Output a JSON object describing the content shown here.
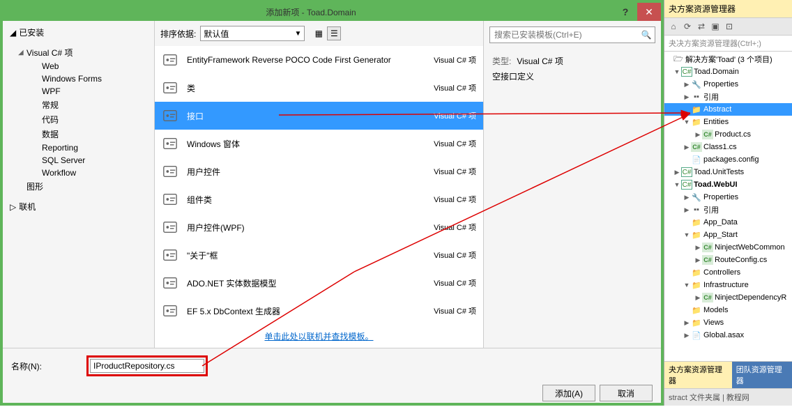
{
  "dialog": {
    "title": "添加新项 - Toad.Domain",
    "help": "?",
    "close": "✕"
  },
  "leftPanel": {
    "installed": "已安装",
    "csharpItems": "Visual C# 项",
    "items": [
      "Web",
      "Windows Forms",
      "WPF",
      "常规",
      "代码",
      "数据",
      "Reporting",
      "SQL Server",
      "Workflow"
    ],
    "graphics": "图形",
    "online": "联机"
  },
  "center": {
    "sortLabel": "排序依据:",
    "sortValue": "默认值",
    "templates": [
      {
        "name": "EntityFramework Reverse POCO Code First Generator",
        "lang": "Visual C# 项"
      },
      {
        "name": "类",
        "lang": "Visual C# 项"
      },
      {
        "name": "接口",
        "lang": "Visual C# 项",
        "selected": true
      },
      {
        "name": "Windows 窗体",
        "lang": "Visual C# 项"
      },
      {
        "name": "用户控件",
        "lang": "Visual C# 项"
      },
      {
        "name": "组件类",
        "lang": "Visual C# 项"
      },
      {
        "name": "用户控件(WPF)",
        "lang": "Visual C# 项"
      },
      {
        "name": "\"关于\"框",
        "lang": "Visual C# 项"
      },
      {
        "name": "ADO.NET 实体数据模型",
        "lang": "Visual C# 项"
      },
      {
        "name": "EF 5.x DbContext 生成器",
        "lang": "Visual C# 项"
      }
    ],
    "onlineLink": "单击此处以联机并查找模板。"
  },
  "right": {
    "searchPlaceholder": "搜索已安装模板(Ctrl+E)",
    "typeLabel": "类型:",
    "typeValue": "Visual C# 项",
    "desc": "空接口定义"
  },
  "bottom": {
    "nameLabel": "名称(N):",
    "nameValue": "IProductRepository.cs",
    "addBtn": "添加(A)",
    "cancelBtn": "取消"
  },
  "sln": {
    "title": "夬方案资源管理器",
    "searchText": "夬决方案资源管理器(Ctrl+;)",
    "solution": "解决方案'Toad' (3 个项目)",
    "nodes": [
      {
        "indent": 1,
        "arrow": "▼",
        "icon": "proj",
        "label": "Toad.Domain"
      },
      {
        "indent": 2,
        "arrow": "▶",
        "icon": "wrench",
        "label": "Properties"
      },
      {
        "indent": 2,
        "arrow": "▶",
        "icon": "ref",
        "label": "引用"
      },
      {
        "indent": 2,
        "arrow": "",
        "icon": "folder",
        "label": "Abstract",
        "selected": true
      },
      {
        "indent": 2,
        "arrow": "▼",
        "icon": "folder",
        "label": "Entities"
      },
      {
        "indent": 3,
        "arrow": "▶",
        "icon": "cs",
        "label": "Product.cs"
      },
      {
        "indent": 2,
        "arrow": "▶",
        "icon": "cs",
        "label": "Class1.cs"
      },
      {
        "indent": 2,
        "arrow": "",
        "icon": "file",
        "label": "packages.config"
      },
      {
        "indent": 1,
        "arrow": "▶",
        "icon": "proj",
        "label": "Toad.UnitTests"
      },
      {
        "indent": 1,
        "arrow": "▼",
        "icon": "proj",
        "label": "Toad.WebUI",
        "bold": true
      },
      {
        "indent": 2,
        "arrow": "▶",
        "icon": "wrench",
        "label": "Properties"
      },
      {
        "indent": 2,
        "arrow": "▶",
        "icon": "ref",
        "label": "引用"
      },
      {
        "indent": 2,
        "arrow": "",
        "icon": "folder",
        "label": "App_Data"
      },
      {
        "indent": 2,
        "arrow": "▼",
        "icon": "folder",
        "label": "App_Start"
      },
      {
        "indent": 3,
        "arrow": "▶",
        "icon": "cs",
        "label": "NinjectWebCommon"
      },
      {
        "indent": 3,
        "arrow": "▶",
        "icon": "cs",
        "label": "RouteConfig.cs"
      },
      {
        "indent": 2,
        "arrow": "",
        "icon": "folder",
        "label": "Controllers"
      },
      {
        "indent": 2,
        "arrow": "▼",
        "icon": "folder",
        "label": "Infrastructure"
      },
      {
        "indent": 3,
        "arrow": "▶",
        "icon": "cs",
        "label": "NinjectDependencyR"
      },
      {
        "indent": 2,
        "arrow": "",
        "icon": "folder",
        "label": "Models"
      },
      {
        "indent": 2,
        "arrow": "▶",
        "icon": "folder",
        "label": "Views"
      },
      {
        "indent": 2,
        "arrow": "▶",
        "icon": "file",
        "label": "Global.asax"
      }
    ],
    "tab1": "夬方案资源管理器",
    "tab2": "团队资源管理器",
    "bottomText": "stract 文件夹属 | 教程网"
  }
}
